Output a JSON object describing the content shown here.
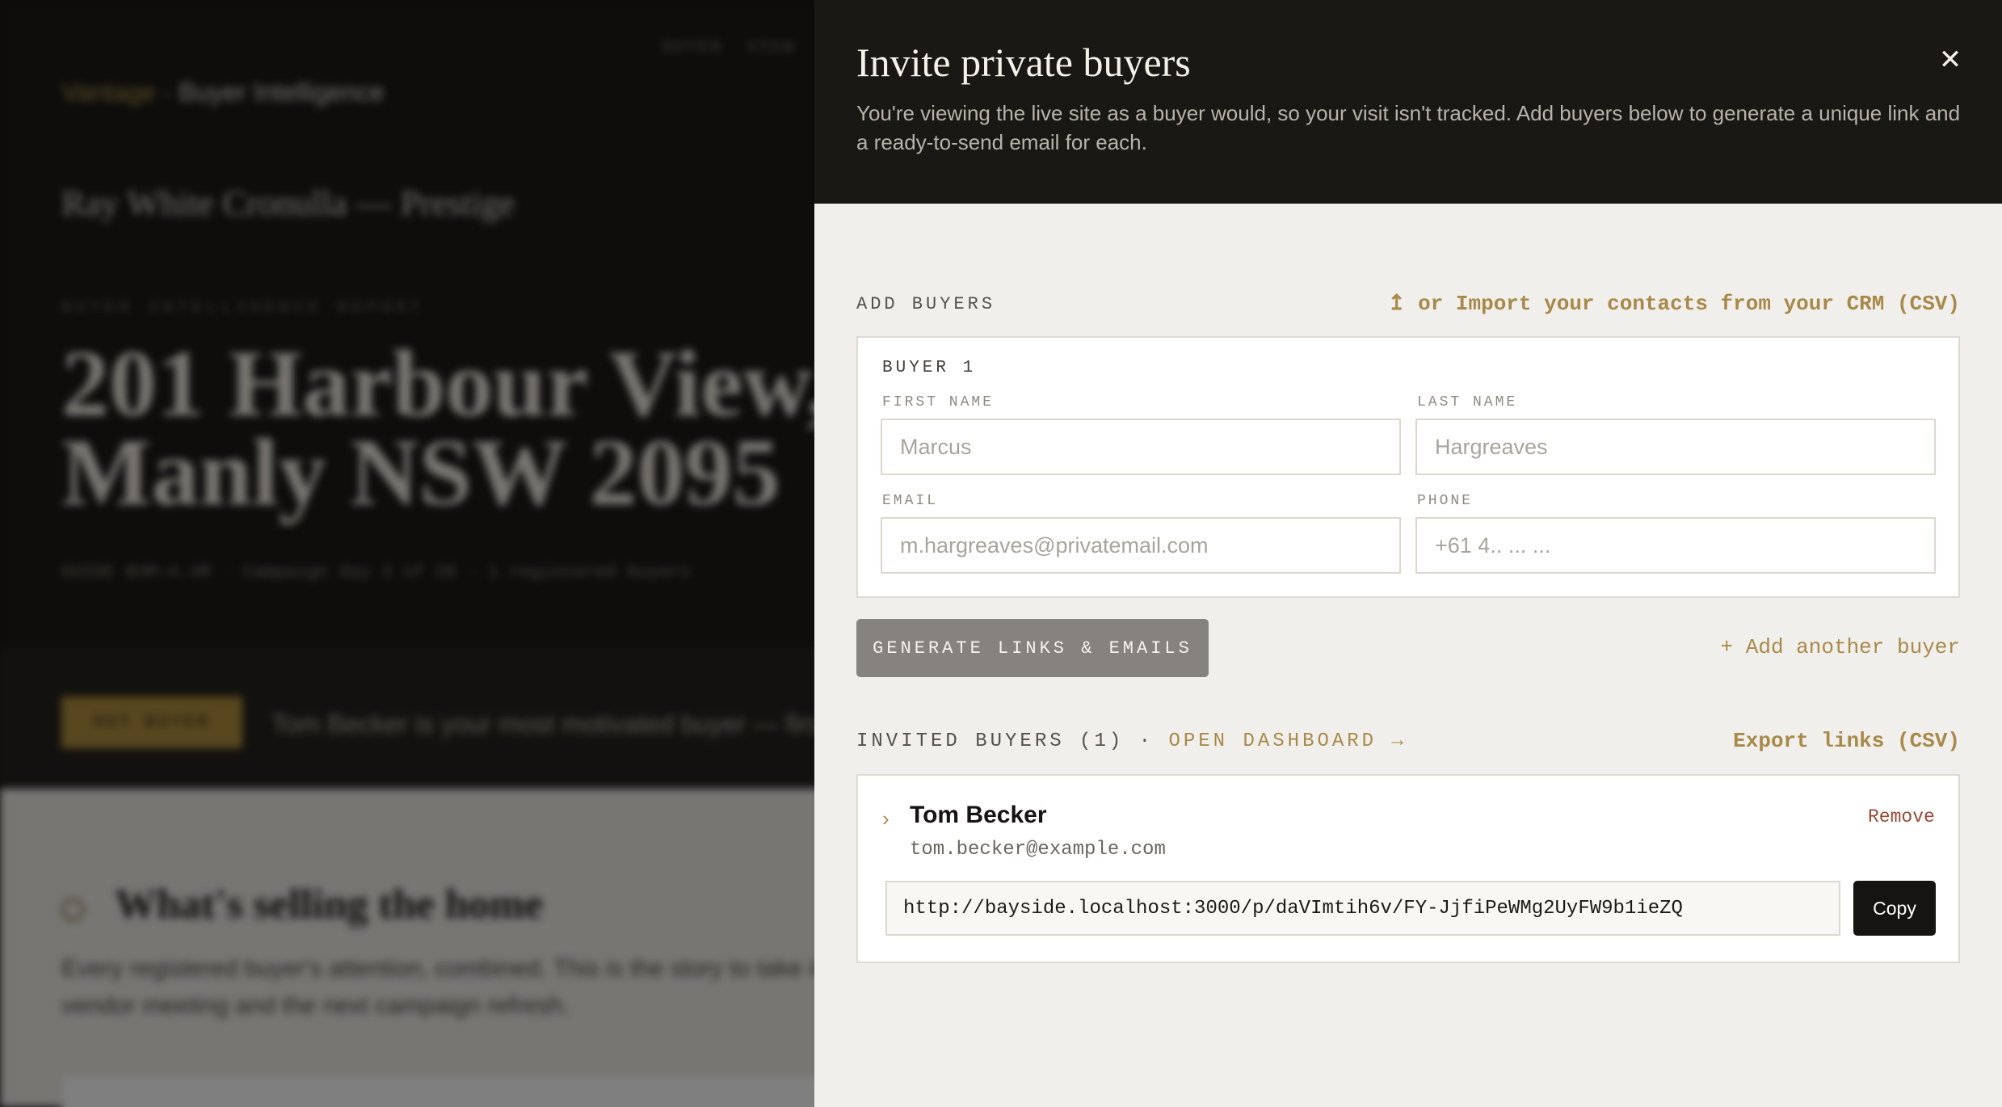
{
  "background": {
    "nav_links": [
      "BUYER",
      "VIEW"
    ],
    "brand": {
      "accent": "Vantage",
      "separator": " · ",
      "name": "Buyer Intelligence"
    },
    "agency": "Ray White Cronulla — Prestige",
    "eyebrow": "BUYER INTELLIGENCE REPORT",
    "headline": "201 Harbour View, Manly NSW 2095",
    "meta": "GUIDE $4M–4.4M · Campaign day 3 of 28 · 1 registered buyers",
    "badge": "HOT BUYER",
    "band_text": "Tom Becker is your most motivated buyer — first to",
    "section_title": "What's selling the home",
    "section_body": "Every registered buyer's attention, combined. This is the story to take into the next vendor meeting and the next campaign refresh."
  },
  "drawer": {
    "title": "Invite private buyers",
    "close_glyph": "✕",
    "description": "You're viewing the live site as a buyer would, so your visit isn't tracked. Add buyers below to generate a unique link and a ready-to-send email for each.",
    "add_buyers_label": "ADD BUYERS",
    "import_link": "↥ or Import your contacts from your CRM (CSV)",
    "buyer_form": {
      "title": "BUYER 1",
      "first_name_label": "FIRST NAME",
      "first_name_placeholder": "Marcus",
      "last_name_label": "LAST NAME",
      "last_name_placeholder": "Hargreaves",
      "email_label": "EMAIL",
      "email_placeholder": "m.hargreaves@privatemail.com",
      "phone_label": "PHONE",
      "phone_placeholder": "+61 4.. ... ..."
    },
    "generate_button": "GENERATE LINKS & EMAILS",
    "add_another": "+ Add another buyer",
    "invited_label": "INVITED BUYERS (1) · ",
    "open_dashboard": "OPEN DASHBOARD →",
    "export_link": "Export links (CSV)",
    "invited_buyers": [
      {
        "chevron": "›",
        "name": "Tom Becker",
        "email": "tom.becker@example.com",
        "remove": "Remove",
        "link": "http://bayside.localhost:3000/p/daVImtih6v/FY-JjfiPeWMg2UyFW9b1ieZQ",
        "copy": "Copy"
      }
    ]
  },
  "colors": {
    "accent_gold": "#a8894a",
    "dark_header": "#1a1815",
    "drawer_bg": "#f1efeb",
    "remove_red": "#9a4a36"
  }
}
